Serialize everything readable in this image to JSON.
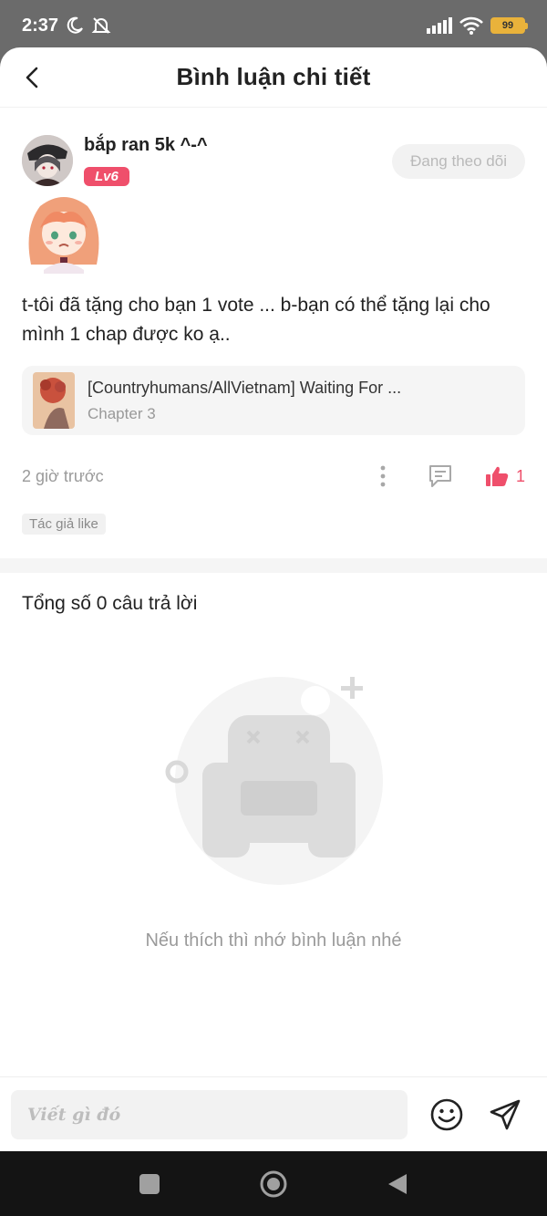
{
  "status_bar": {
    "time": "2:37",
    "battery": "99",
    "icons": [
      "moon-icon",
      "bell-off-icon",
      "signal-icon",
      "wifi-icon",
      "battery-icon"
    ]
  },
  "header": {
    "title": "Bình luận chi tiết",
    "back_icon": "chevron-left-icon"
  },
  "comment": {
    "username": "bắp ran 5k ^-^",
    "level": "Lv6",
    "follow_label": "Đang theo dõi",
    "text": "t-tôi đã tặng cho bạn 1 vote ... b-bạn có thể tặng lại cho mình 1 chap được ko ạ..",
    "chapter": {
      "title": "[Countryhumans/AllVietnam] Waiting For ...",
      "subtitle": "Chapter 3"
    },
    "time": "2 giờ trước",
    "like_count": "1",
    "author_tag": "Tác giả like"
  },
  "replies": {
    "title": "Tổng số 0 câu trả lời",
    "empty_text": "Nếu thích thì nhớ bình luận nhé"
  },
  "input": {
    "placeholder": "Viết gì đó"
  },
  "colors": {
    "accent": "#ef4f6b",
    "muted_text": "#9a9a9a",
    "status_bar_bg": "#6b6b6b",
    "nav_bar_bg": "#141414"
  }
}
